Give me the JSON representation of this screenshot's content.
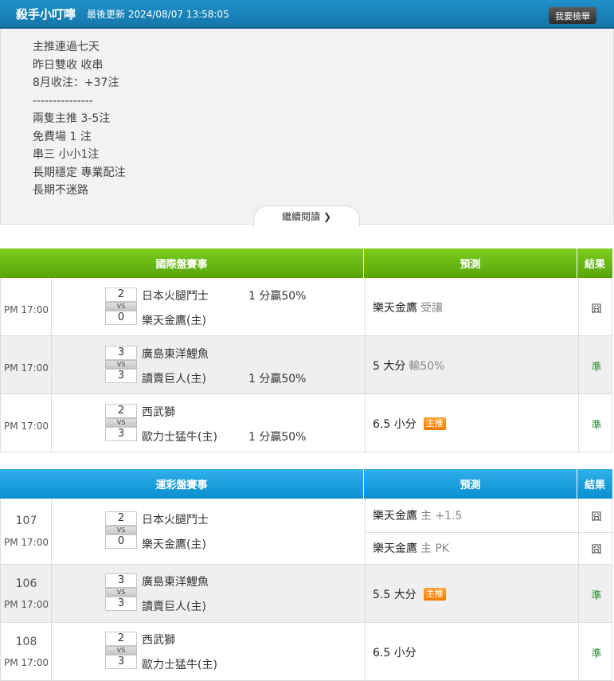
{
  "header": {
    "title": "殺手小叮嚀",
    "last_update": "最後更新 2024/08/07 13:58:05",
    "report_label": "我要檢舉"
  },
  "intro": {
    "lines": [
      "主推連過七天",
      "昨日雙收 收串",
      "8月收注：+37注",
      "---------------",
      "兩隻主推 3-5注",
      "免費場 1 注",
      "串三 小小1注",
      "長期穩定 專業配注",
      "長期不迷路"
    ],
    "read_more": "繼續閱讀"
  },
  "intl": {
    "headers": {
      "match": "國際盤賽事",
      "predict": "預測",
      "result": "結果"
    },
    "rows": [
      {
        "time": "PM 17:00",
        "away": "日本火腿鬥士",
        "home": "樂天金鷹(主)",
        "away_score": "2",
        "home_score": "0",
        "odds_away": "1 分贏50%",
        "odds_home": "",
        "pred": "樂天金鷹",
        "pred_sub": "受讓",
        "badge": "",
        "result": "囧",
        "win": false
      },
      {
        "time": "PM 17:00",
        "away": "廣島東洋鯉魚",
        "home": "讀賣巨人(主)",
        "away_score": "3",
        "home_score": "3",
        "odds_away": "",
        "odds_home": "1 分贏50%",
        "pred": "5 大分",
        "pred_sub": "輸50%",
        "badge": "",
        "result": "準",
        "win": true
      },
      {
        "time": "PM 17:00",
        "away": "西武獅",
        "home": "歐力士猛牛(主)",
        "away_score": "2",
        "home_score": "3",
        "odds_away": "",
        "odds_home": "1 分贏50%",
        "pred": "6.5 小分",
        "pred_sub": "",
        "badge": "主推",
        "result": "準",
        "win": true
      }
    ]
  },
  "sports": {
    "headers": {
      "match": "運彩盤賽事",
      "predict": "預測",
      "result": "結果"
    },
    "rows": [
      {
        "num": "107",
        "time": "PM 17:00",
        "away": "日本火腿鬥士",
        "home": "樂天金鷹(主)",
        "away_score": "2",
        "home_score": "0",
        "preds": [
          {
            "pred": "樂天金鷹",
            "pred_sub": "主 +1.5",
            "badge": "",
            "result": "囧",
            "win": false
          },
          {
            "pred": "樂天金鷹",
            "pred_sub": "主 PK",
            "badge": "",
            "result": "囧",
            "win": false
          }
        ]
      },
      {
        "num": "106",
        "time": "PM 17:00",
        "away": "廣島東洋鯉魚",
        "home": "讀賣巨人(主)",
        "away_score": "3",
        "home_score": "3",
        "preds": [
          {
            "pred": "5.5 大分",
            "pred_sub": "",
            "badge": "主推",
            "result": "準",
            "win": true
          }
        ]
      },
      {
        "num": "108",
        "time": "PM 17:00",
        "away": "西武獅",
        "home": "歐力士猛牛(主)",
        "away_score": "2",
        "home_score": "3",
        "preds": [
          {
            "pred": "6.5 小分",
            "pred_sub": "",
            "badge": "",
            "result": "準",
            "win": true
          }
        ]
      }
    ]
  }
}
